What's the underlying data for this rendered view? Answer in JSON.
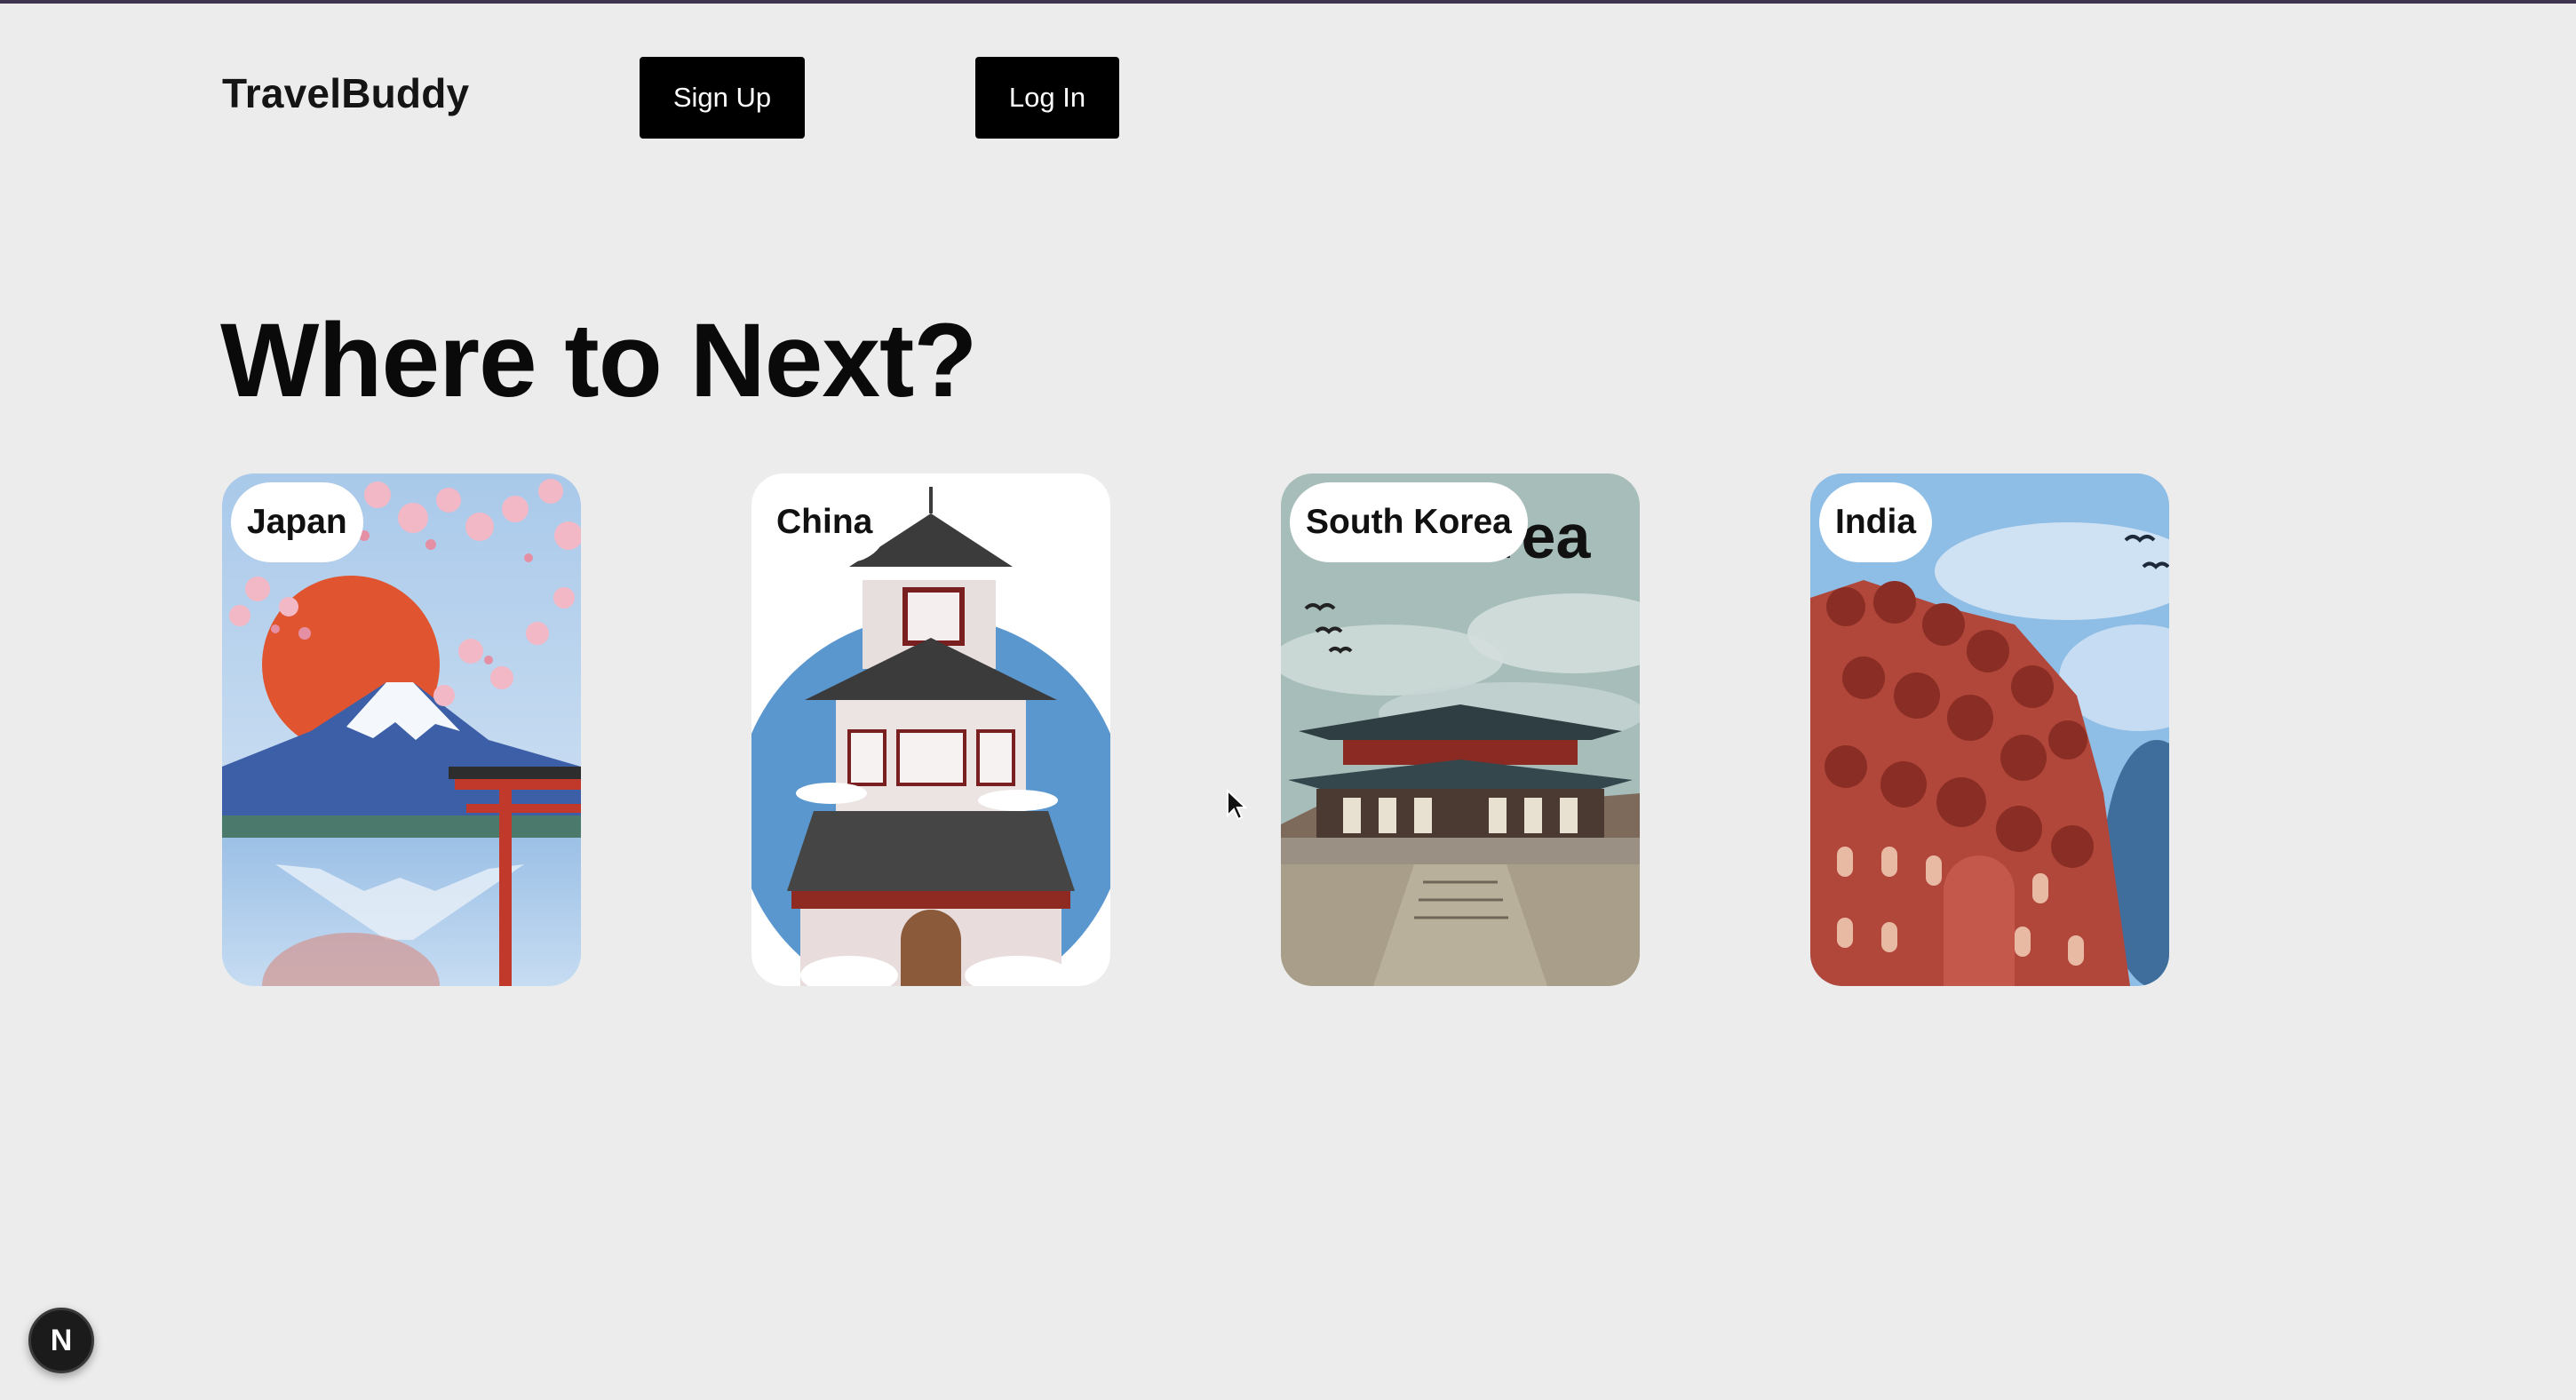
{
  "header": {
    "brand": "TravelBuddy",
    "signup_label": "Sign Up",
    "login_label": "Log In"
  },
  "hero": {
    "title": "Where to Next?"
  },
  "destinations": [
    {
      "label": "Japan",
      "image_icon": "mount-fuji-torii-illustration"
    },
    {
      "label": "China",
      "image_icon": "pagoda-illustration"
    },
    {
      "label": "South Korea",
      "image_icon": "korean-palace-illustration",
      "image_text": "Korea"
    },
    {
      "label": "India",
      "image_icon": "hawa-mahal-illustration"
    }
  ],
  "dev_badge": {
    "label": "N"
  },
  "colors": {
    "page_background": "#ececec",
    "button_background": "#000000",
    "button_text": "#ffffff",
    "top_rule": "#3f3550"
  }
}
